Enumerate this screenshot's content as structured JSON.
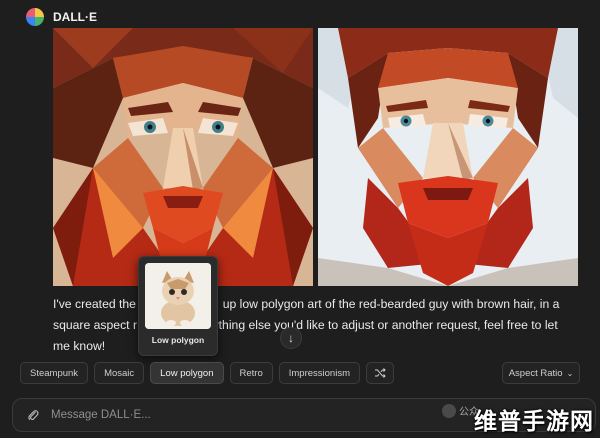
{
  "header": {
    "app_name": "DALL·E"
  },
  "images": [
    {
      "name": "low-polygon-portrait-1"
    },
    {
      "name": "low-polygon-portrait-2"
    }
  ],
  "message": {
    "line1_start": "I've created the",
    "line1_end": "up low polygon art of the red-bearded guy with brown hair, in a",
    "line2_start": "square aspect r",
    "line2_end": "nything else you'd like to adjust or another request, feel free to let",
    "line3": "me know!"
  },
  "preview": {
    "label": "Low polygon"
  },
  "style_chips": [
    {
      "label": "Steampunk",
      "active": false
    },
    {
      "label": "Mosaic",
      "active": false
    },
    {
      "label": "Low polygon",
      "active": true
    },
    {
      "label": "Retro",
      "active": false
    },
    {
      "label": "Impressionism",
      "active": false
    }
  ],
  "shuffle": {
    "icon": "shuffle-icon"
  },
  "aspect_ratio": {
    "label": "Aspect Ratio",
    "icon": "chevron-down-icon"
  },
  "composer": {
    "placeholder": "Message DALL·E..."
  },
  "watermark": {
    "small_text": "公众",
    "big_text": "维普手游网"
  },
  "colors": {
    "background": "#1e1e1e",
    "beard": "#c9301c",
    "chip_border": "#3c3c3c"
  }
}
